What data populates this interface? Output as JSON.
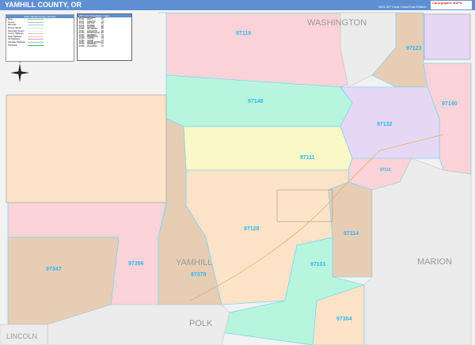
{
  "header": {
    "title": "YAMHILL COUNTY, OR",
    "edition": "2022 ZIP Code Color/Cast Edition",
    "logo": "Cartographic MAPS"
  },
  "legend": {
    "title": "2022 Yamhill County, OR Map",
    "items": [
      {
        "label": "State",
        "color": "#7fd67f"
      },
      {
        "label": "County",
        "color": "#bbbbbb"
      },
      {
        "label": "ZIP Code",
        "color": "#7fd6f0"
      },
      {
        "label": "Primary Streets",
        "color": "#dddddd"
      },
      {
        "label": "Secondary Streets",
        "color": "#eeeeee"
      },
      {
        "label": "County Highways",
        "color": "#cccccc"
      },
      {
        "label": "State Highways",
        "color": "#f4c08a"
      },
      {
        "label": "US Highways",
        "color": "#f08ac8"
      },
      {
        "label": "Interstate Highways",
        "color": "#7fc0f0"
      },
      {
        "label": "Toll Roads",
        "color": "#40c040"
      }
    ]
  },
  "zip_locator": {
    "title": "ZIP Code Index/Grid Locator",
    "columns": [
      "ZIP Code",
      "ZIP Name",
      "Grid"
    ],
    "rows": [
      [
        "97101",
        "AMITY",
        "F6"
      ],
      [
        "97111",
        "CARLTON",
        "C5"
      ],
      [
        "97114",
        "DAYTON",
        "E6"
      ],
      [
        "97115",
        "DUNDEE",
        "D7"
      ],
      [
        "97119",
        "GASTON",
        "B5"
      ],
      [
        "97123",
        "HILLSBORO",
        "B7"
      ],
      [
        "97127",
        "LAFAYETTE",
        "D6"
      ],
      [
        "97128",
        "MCMINNVILLE",
        "E5"
      ],
      [
        "97132",
        "NEWBERG",
        "C7"
      ],
      [
        "97140",
        "SHERWOOD",
        "C8"
      ],
      [
        "97148",
        "YAMHILL",
        "C5"
      ],
      [
        "97304",
        "SALEM",
        "G7"
      ],
      [
        "97347",
        "GRAND RONDE",
        "F2"
      ],
      [
        "97378",
        "SHERIDAN",
        "F4"
      ],
      [
        "97396",
        "WILLAMINA",
        "F3"
      ]
    ]
  },
  "map": {
    "counties": [
      "WASHINGTON",
      "YAMHILL",
      "MARION",
      "POLK",
      "LINCOLN"
    ],
    "zips": [
      "97119",
      "97123",
      "97140",
      "97148",
      "97132",
      "97111",
      "97115",
      "97128",
      "97114",
      "97396",
      "97347",
      "97378",
      "97101",
      "97304"
    ],
    "compass": "N"
  }
}
